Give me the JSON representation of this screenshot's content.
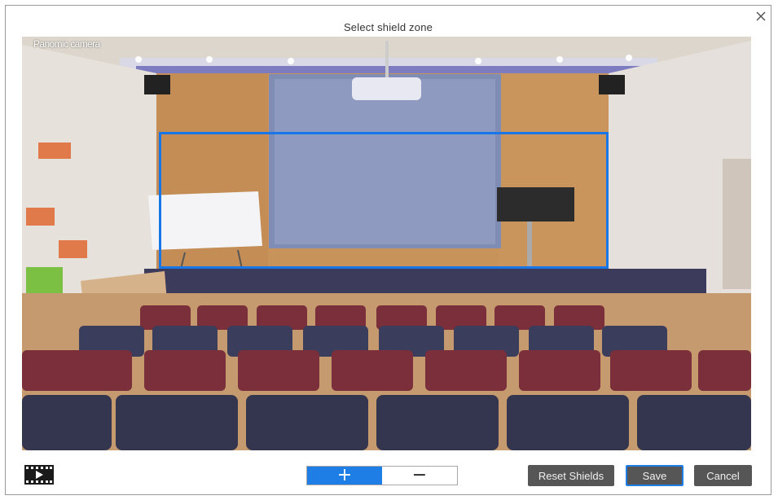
{
  "dialog": {
    "title": "Select shield zone",
    "close_icon": "close-icon"
  },
  "viewer": {
    "camera_label": "Panomic camera"
  },
  "toolbar": {
    "playback_icon": "film-play-icon",
    "zoom_in_label": "+",
    "zoom_out_label": "−",
    "reset_label": "Reset Shields",
    "save_label": "Save",
    "cancel_label": "Cancel"
  },
  "colors": {
    "accent": "#1f7de6",
    "shield_border": "#1976e8",
    "button_bg": "#565656"
  }
}
